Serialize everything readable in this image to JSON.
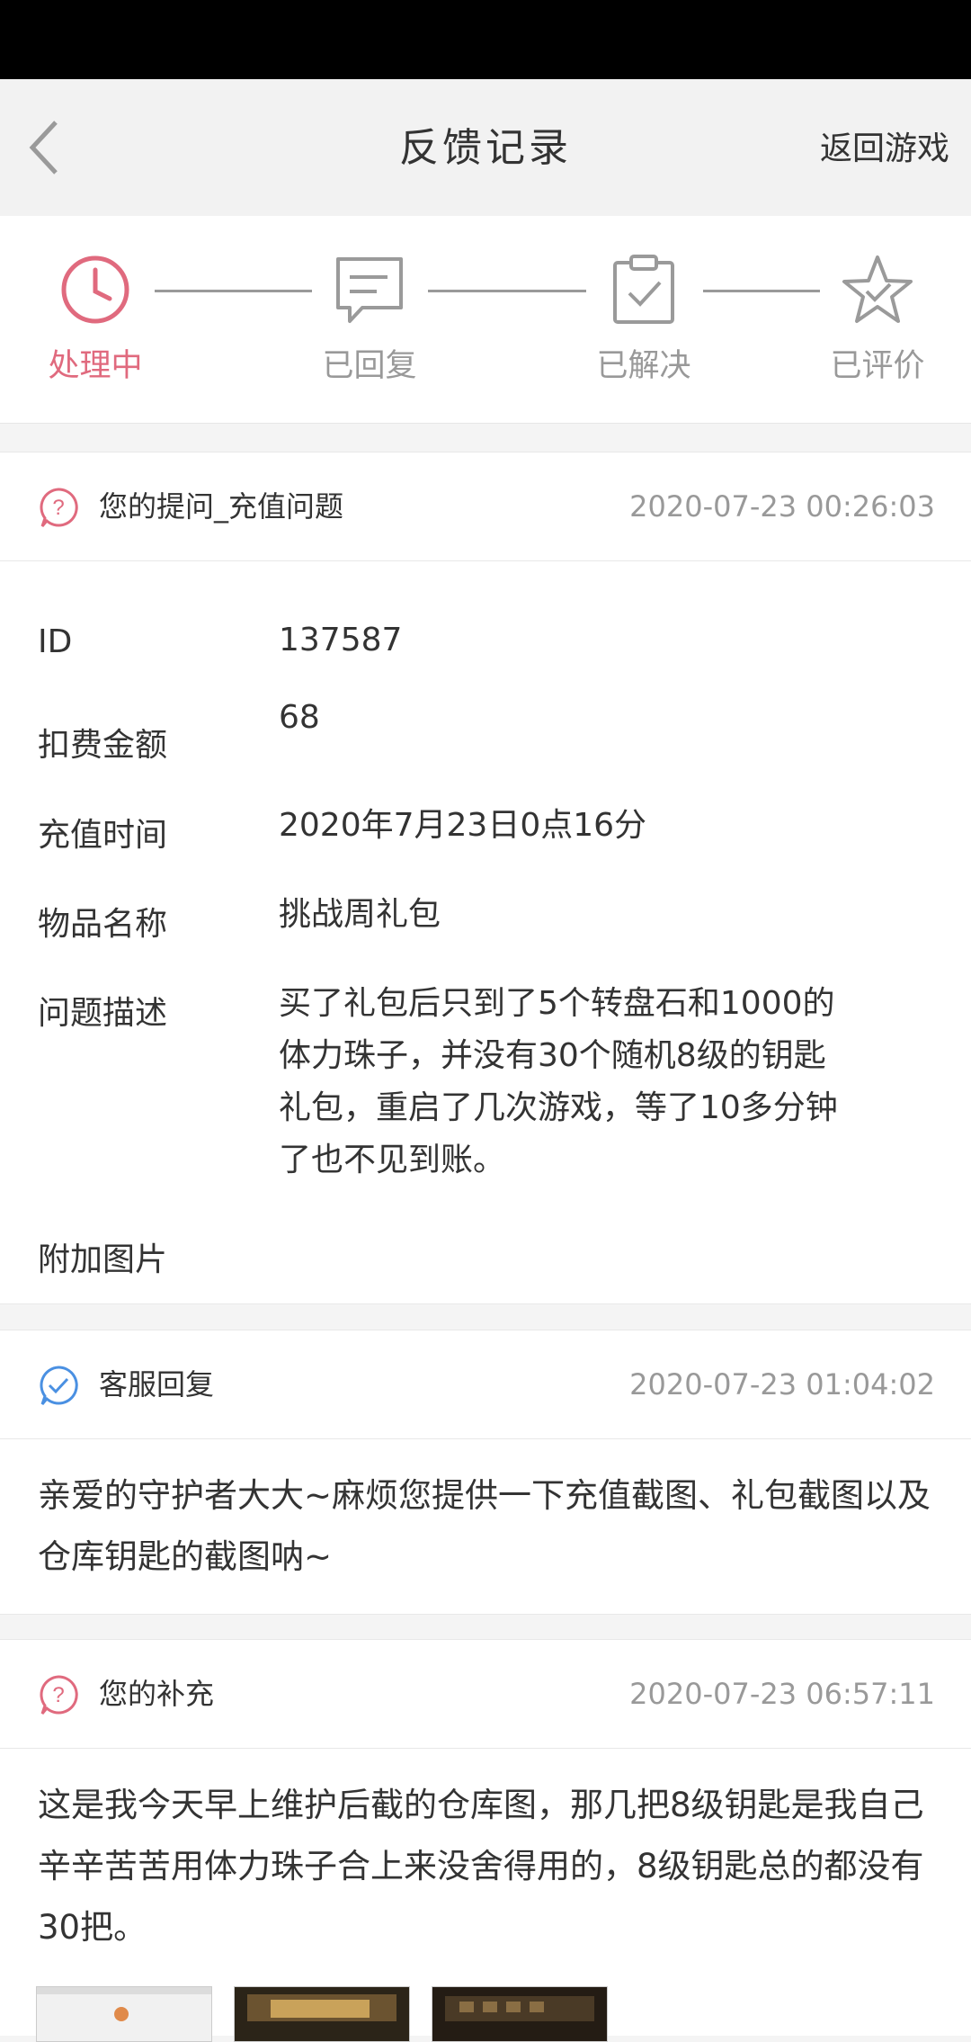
{
  "header": {
    "title": "反馈记录",
    "return_label": "返回游戏"
  },
  "steps": [
    {
      "label": "处理中",
      "icon": "clock-icon",
      "active": true
    },
    {
      "label": "已回复",
      "icon": "message-icon",
      "active": false
    },
    {
      "label": "已解决",
      "icon": "clipboard-check-icon",
      "active": false
    },
    {
      "label": "已评价",
      "icon": "star-check-icon",
      "active": false
    }
  ],
  "question": {
    "title": "您的提问_充值问题",
    "time": "2020-07-23 00:26:03",
    "fields": [
      {
        "label": "ID",
        "value": "137587"
      },
      {
        "label": "扣费金额",
        "value": "68"
      },
      {
        "label": "充值时间",
        "value": "2020年7月23日0点16分"
      },
      {
        "label": "物品名称",
        "value": "挑战周礼包"
      },
      {
        "label": "问题描述",
        "value": "买了礼包后只到了5个转盘石和1000的体力珠子，并没有30个随机8级的钥匙礼包，重启了几次游戏，等了10多分钟了也不见到账。"
      },
      {
        "label": "附加图片",
        "value": ""
      }
    ]
  },
  "reply": {
    "title": "客服回复",
    "time": "2020-07-23 01:04:02",
    "text": "亲爱的守护者大大~麻烦您提供一下充值截图、礼包截图以及仓库钥匙的截图呐~"
  },
  "supplement": {
    "title": "您的补充",
    "time": "2020-07-23 06:57:11",
    "text": "这是我今天早上维护后截的仓库图，那几把8级钥匙是我自己辛辛苦苦用体力珠子合上来没舍得用的，8级钥匙总的都没有30把。"
  },
  "colors": {
    "accent": "#e06a7e",
    "reply_blue": "#4a90e2",
    "muted": "#999999"
  }
}
